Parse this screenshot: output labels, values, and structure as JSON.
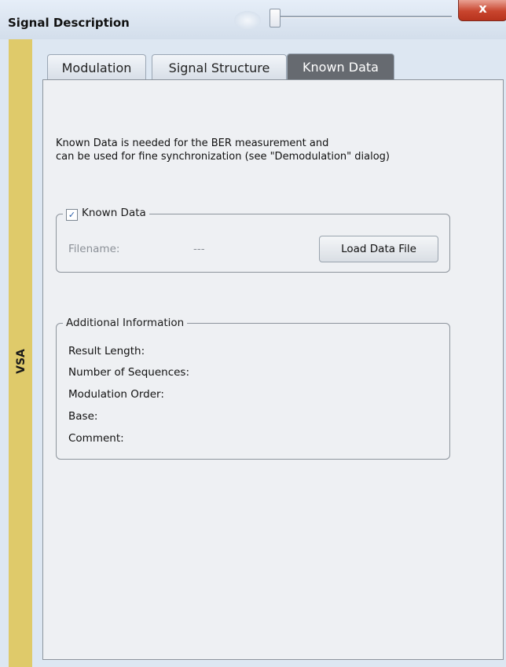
{
  "window": {
    "title": "Signal Description",
    "close_glyph": "x"
  },
  "side_label": "VSA",
  "tabs": [
    {
      "label": "Modulation",
      "active": false
    },
    {
      "label": "Signal Structure",
      "active": false
    },
    {
      "label": "Known Data",
      "active": true
    }
  ],
  "description": {
    "line1": "Known Data is needed for the BER measurement and",
    "line2": "can be used for fine synchronization (see \"Demodulation\" dialog)"
  },
  "known_data_group": {
    "checkbox_label": "Known Data",
    "checked": true,
    "filename_label": "Filename:",
    "filename_value": "---",
    "load_button": "Load Data File"
  },
  "additional_info": {
    "title": "Additional Information",
    "items": [
      "Result Length:",
      "Number of Sequences:",
      "Modulation Order:",
      "Base:",
      "Comment:"
    ]
  },
  "colors": {
    "side_strip": "#dfca6a",
    "active_tab": "#666a70",
    "close_button": "#c8452e"
  }
}
